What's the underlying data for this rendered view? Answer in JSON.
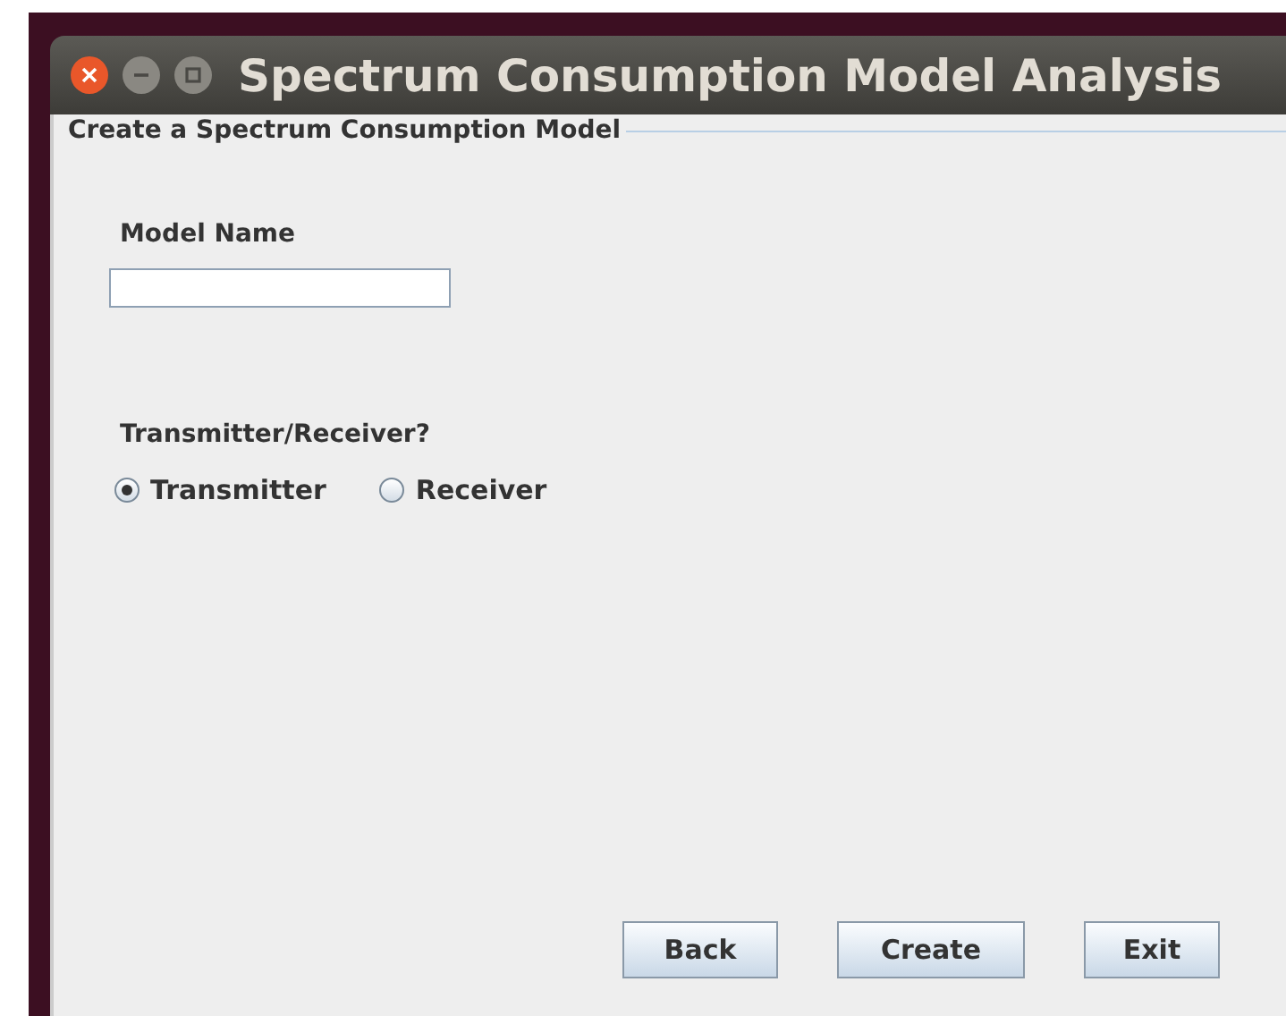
{
  "window": {
    "title": "Spectrum Consumption Model Analysis"
  },
  "panel": {
    "title": "Create a Spectrum Consumption Model"
  },
  "model_name": {
    "label": "Model Name"
  },
  "role": {
    "label": "Transmitter/Receiver?",
    "options": [
      {
        "label": "Transmitter",
        "selected": true
      },
      {
        "label": "Receiver",
        "selected": false
      }
    ]
  },
  "buttons": [
    "Back",
    "Create",
    "Exit"
  ]
}
